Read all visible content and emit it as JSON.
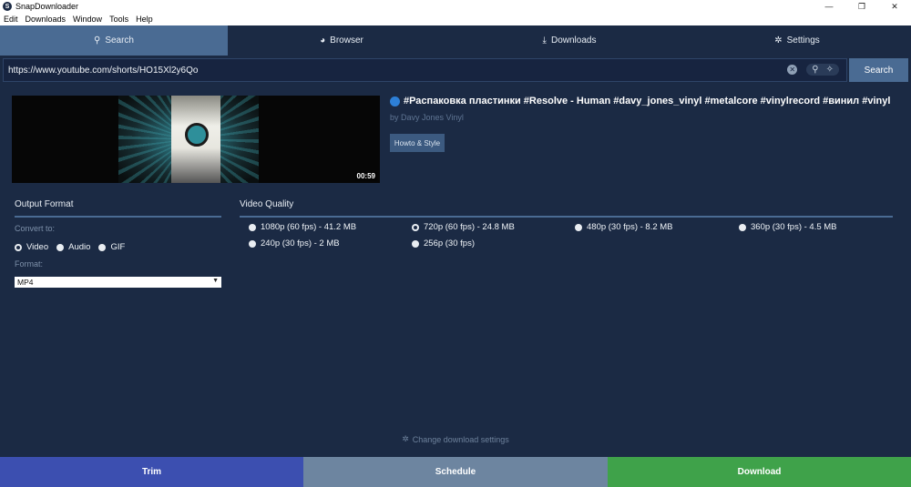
{
  "window": {
    "title": "SnapDownloader",
    "app_icon_glyph": "S",
    "controls": {
      "minimize": "—",
      "maximize": "❐",
      "close": "✕"
    }
  },
  "menubar": [
    "Edit",
    "Downloads",
    "Window",
    "Tools",
    "Help"
  ],
  "tabs": [
    {
      "label": "Search",
      "icon": "search-icon",
      "glyph": "⚲",
      "active": true
    },
    {
      "label": "Browser",
      "icon": "globe-icon",
      "glyph": "◕",
      "active": false
    },
    {
      "label": "Downloads",
      "icon": "download-icon",
      "glyph": "⤓",
      "active": false
    },
    {
      "label": "Settings",
      "icon": "gear-icon",
      "glyph": "✲",
      "active": false
    }
  ],
  "search": {
    "url": "https://www.youtube.com/shorts/HO15Xl2y6Qo",
    "button_label": "Search",
    "clear_glyph": "✕",
    "picker_glyph": "⚲",
    "wand_glyph": "✧"
  },
  "video": {
    "duration": "00:59",
    "title": "#Распаковка пластинки #Resolve - Human #davy_jones_vinyl #metalcore #vinylrecord #винил #vinyl",
    "author": "by Davy Jones Vinyl",
    "category": "Howto & Style"
  },
  "output_format": {
    "heading": "Output Format",
    "convert_label": "Convert to:",
    "convert_options": [
      {
        "label": "Video",
        "checked": true
      },
      {
        "label": "Audio",
        "checked": false
      },
      {
        "label": "GIF",
        "checked": false
      }
    ],
    "format_label": "Format:",
    "format_value": "MP4"
  },
  "video_quality": {
    "heading": "Video Quality",
    "options": [
      {
        "label": "1080p (60 fps) - 41.2 MB",
        "checked": false
      },
      {
        "label": "720p (60 fps) - 24.8 MB",
        "checked": true
      },
      {
        "label": "480p (30 fps) - 8.2 MB",
        "checked": false
      },
      {
        "label": "360p (30 fps) - 4.5 MB",
        "checked": false
      },
      {
        "label": "240p (30 fps) - 2 MB",
        "checked": false
      },
      {
        "label": "256p (30 fps)",
        "checked": false
      }
    ]
  },
  "footer": {
    "settings_link": "Change download settings",
    "settings_glyph": "✲",
    "buttons": {
      "trim": "Trim",
      "schedule": "Schedule",
      "download": "Download"
    },
    "colors": {
      "trim": "#3c4fb0",
      "schedule": "#6d85a0",
      "download": "#3fa24a"
    }
  }
}
